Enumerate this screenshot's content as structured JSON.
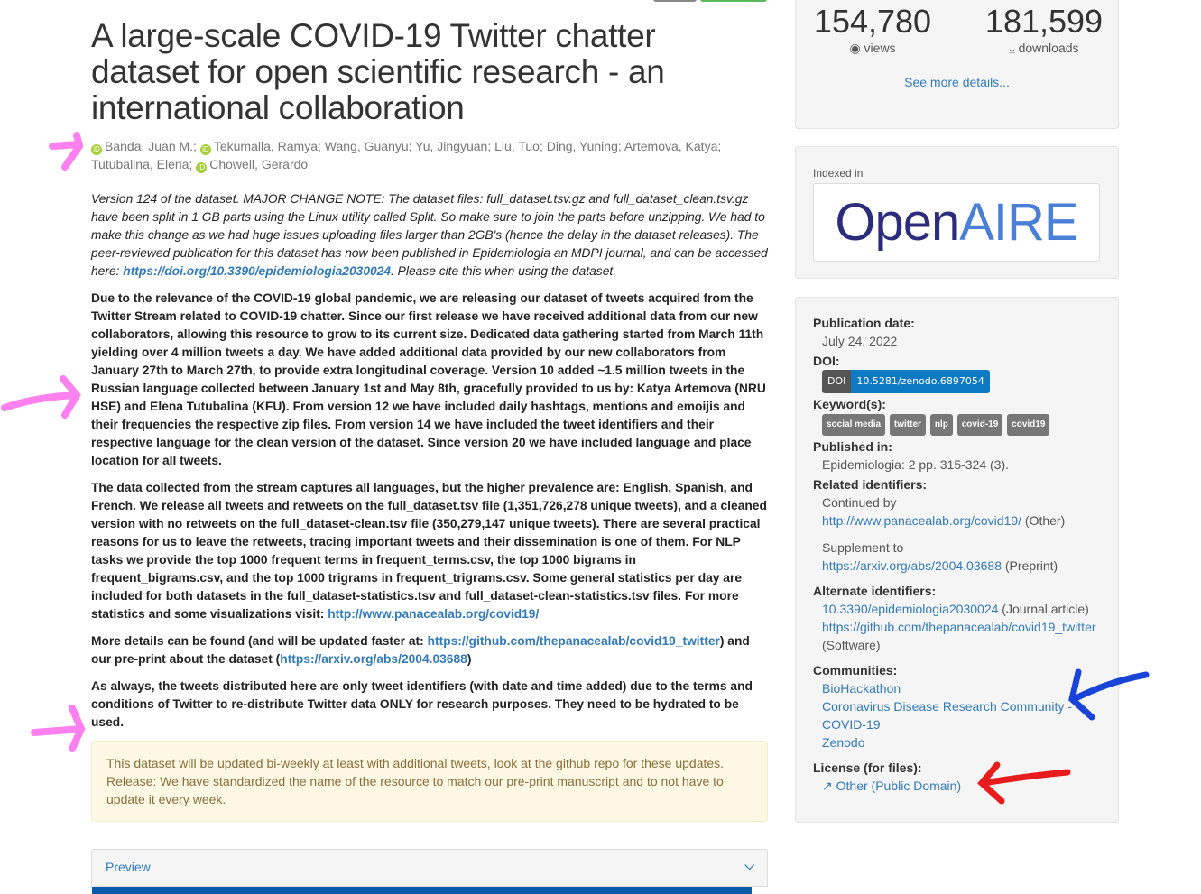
{
  "title": "A large-scale COVID-19 Twitter chatter dataset for open scientific research - an international collaboration",
  "authors": {
    "a1": "Banda, Juan M.;",
    "a2": "Tekumalla, Ramya;",
    "rest": "Wang, Guanyu; Yu, Jingyuan; Liu, Tuo; Ding, Yuning; Artemova, Katya; Tutubalina, Elena;",
    "a3": "Chowell, Gerardo"
  },
  "desc": {
    "p1a": "Version 124 of the dataset. MAJOR CHANGE NOTE: The dataset files: full_dataset.tsv.gz and full_dataset_clean.tsv.gz have been split in 1 GB parts using the Linux utility called Split. So make sure to join the parts before unzipping. We had to make this change as we had huge issues uploading files larger than 2GB's (hence the delay in the dataset releases). The peer-reviewed publication for this dataset has now been published  in Epidemiologia an MDPI journal, and can be accessed here: ",
    "p1link": "https://doi.org/10.3390/epidemiologia2030024",
    "p1b": ". Please cite this when using the dataset.",
    "p2": "Due to the relevance of the COVID-19 global pandemic, we are releasing our dataset of tweets acquired from the Twitter Stream related to COVID-19 chatter. Since our first release we have received additional data from our new collaborators, allowing this resource to grow to its current size. Dedicated data gathering started from March 11th yielding over 4 million tweets a day. We have added additional data provided by our new collaborators from January 27th to March 27th, to provide extra longitudinal coverage. Version 10 added ~1.5 million tweets in the Russian language collected between January 1st and May 8th, gracefully provided to us by: Katya Artemova (NRU HSE) and Elena Tutubalina (KFU). From version 12 we have included daily hashtags, mentions and emoijis and their frequencies the respective zip files. From version 14 we have included the tweet identifiers and their respective language for the clean version of the dataset. Since version 20 we have included language and place location for all tweets.",
    "p3": "The data collected from the stream captures all languages, but the higher prevalence are:  English, Spanish, and French. We release all tweets and retweets on the full_dataset.tsv file (1,351,726,278 unique tweets), and a cleaned version with no retweets on the full_dataset-clean.tsv file (350,279,147 unique tweets). There are several practical reasons for us to leave the retweets, tracing important tweets and their dissemination is one of them. For NLP tasks we provide the top 1000 frequent terms in frequent_terms.csv, the top 1000 bigrams in frequent_bigrams.csv, and the top 1000 trigrams in frequent_trigrams.csv. Some general statistics per day are included for both datasets in the full_dataset-statistics.tsv and full_dataset-clean-statistics.tsv files. For more statistics and some visualizations visit: ",
    "p3link": "http://www.panacealab.org/covid19/",
    "p4a": "More details can be found (and will be updated faster at: ",
    "p4link1": "https://github.com/thepanacealab/covid19_twitter",
    "p4b": ") and our pre-print about the dataset (",
    "p4link2": "https://arxiv.org/abs/2004.03688",
    "p4c": ")",
    "p5": "As always, the tweets distributed here are only tweet identifiers (with date and time added) due to the terms and conditions of Twitter to re-distribute Twitter data ONLY for research purposes. They need to be hydrated to be used."
  },
  "notice": {
    "line1": "This dataset will be updated bi-weekly at least with additional tweets, look at the github repo for these updates.",
    "line2": "Release: We have standardized the name of the resource to match our pre-print manuscript and to not have to update it every week."
  },
  "preview": {
    "label": "Preview"
  },
  "stats": {
    "views": "154,780",
    "views_label": "views",
    "downloads": "181,599",
    "downloads_label": "downloads",
    "more": "See more details..."
  },
  "indexed": {
    "label": "Indexed in",
    "logo": "OpenAIRE"
  },
  "meta": {
    "pub_date_label": "Publication date:",
    "pub_date": "July 24, 2022",
    "doi_label": "DOI:",
    "doi_prefix": "DOI",
    "doi": "10.5281/zenodo.6897054",
    "keywords_label": "Keyword(s):",
    "keywords": [
      "social media",
      "twitter",
      "nlp",
      "covid-19",
      "covid19"
    ],
    "published_in_label": "Published in:",
    "published_in": "Epidemiologia: 2 pp. 315-324 (3).",
    "related_label": "Related identifiers:",
    "related": [
      {
        "rel": "Continued by",
        "link": "http://www.panacealab.org/covid19/",
        "type": "(Other)"
      },
      {
        "rel": "Supplement to",
        "link": "https://arxiv.org/abs/2004.03688",
        "type": "(Preprint)"
      }
    ],
    "alt_label": "Alternate identifiers:",
    "alt": [
      {
        "link": "10.3390/epidemiologia2030024",
        "type": "(Journal article)"
      },
      {
        "link": "https://github.com/thepanacealab/covid19_twitter",
        "type": "(Software)"
      }
    ],
    "communities_label": "Communities:",
    "communities": [
      "BioHackathon",
      "Coronavirus Disease Research Community - COVID-19",
      "Zenodo"
    ],
    "license_label": "License (for files):",
    "license": "Other (Public Domain)"
  }
}
